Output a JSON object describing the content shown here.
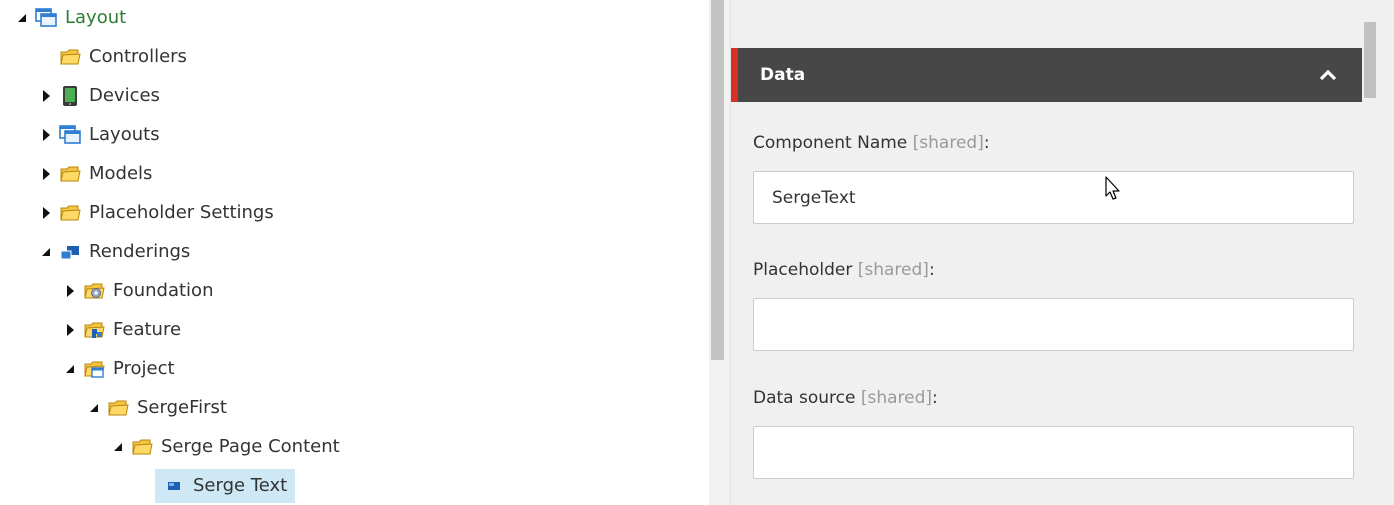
{
  "tree": {
    "items": [
      {
        "label": "Layout",
        "icon": "layout-window-icon",
        "state": "expanded"
      },
      {
        "label": "Controllers",
        "icon": "folder-icon",
        "state": "leaf"
      },
      {
        "label": "Devices",
        "icon": "device-icon",
        "state": "collapsed"
      },
      {
        "label": "Layouts",
        "icon": "layout-window-icon",
        "state": "collapsed"
      },
      {
        "label": "Models",
        "icon": "folder-icon",
        "state": "collapsed"
      },
      {
        "label": "Placeholder Settings",
        "icon": "folder-icon",
        "state": "collapsed"
      },
      {
        "label": "Renderings",
        "icon": "renderings-icon",
        "state": "expanded"
      },
      {
        "label": "Foundation",
        "icon": "folder-gear-icon",
        "state": "collapsed"
      },
      {
        "label": "Feature",
        "icon": "folder-blocks-icon",
        "state": "collapsed"
      },
      {
        "label": "Project",
        "icon": "folder-window-icon",
        "state": "expanded"
      },
      {
        "label": "SergeFirst",
        "icon": "folder-icon",
        "state": "expanded"
      },
      {
        "label": "Serge Page Content",
        "icon": "folder-icon",
        "state": "expanded"
      },
      {
        "label": "Serge Text",
        "icon": "rendering-item-icon",
        "state": "selected"
      }
    ]
  },
  "section": {
    "title": "Data",
    "collapse_icon": "chevron-up-icon"
  },
  "fields": {
    "component_name": {
      "label": "Component Name",
      "tag": "[shared]",
      "colon": ":",
      "value": "SergeText"
    },
    "placeholder": {
      "label": "Placeholder",
      "tag": "[shared]",
      "colon": ":",
      "value": ""
    },
    "data_source": {
      "label": "Data source",
      "tag": "[shared]",
      "colon": ":",
      "value": ""
    }
  },
  "colors": {
    "section_header_bg": "#474747",
    "section_accent": "#d93025",
    "selected_row_bg": "#cfe8f6",
    "root_label": "#2e7d32"
  }
}
